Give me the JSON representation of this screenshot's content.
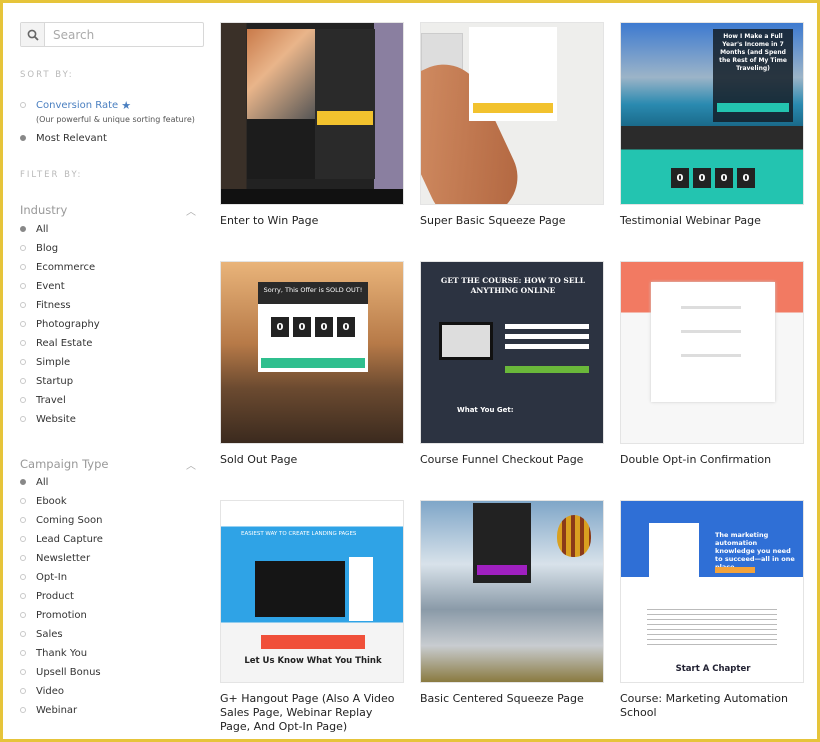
{
  "search": {
    "placeholder": "Search",
    "icon": "search-icon"
  },
  "sort": {
    "label": "SORT BY:",
    "options": [
      {
        "label": "Conversion Rate",
        "note": "(Our powerful & unique sorting feature)",
        "selected": false,
        "icon": "star-icon"
      },
      {
        "label": "Most Relevant",
        "selected": true
      }
    ]
  },
  "filter": {
    "label": "FILTER BY:"
  },
  "industry": {
    "heading": "Industry",
    "items": [
      "All",
      "Blog",
      "Ecommerce",
      "Event",
      "Fitness",
      "Photography",
      "Real Estate",
      "Simple",
      "Startup",
      "Travel",
      "Website"
    ],
    "selected": "All"
  },
  "campaign": {
    "heading": "Campaign Type",
    "items": [
      "All",
      "Ebook",
      "Coming Soon",
      "Lead Capture",
      "Newsletter",
      "Opt-In",
      "Product",
      "Promotion",
      "Sales",
      "Thank You",
      "Upsell Bonus",
      "Video",
      "Webinar"
    ],
    "selected": "All"
  },
  "templates": [
    {
      "title": "Enter to Win Page"
    },
    {
      "title": "Super Basic Squeeze Page"
    },
    {
      "title": "Testimonial Webinar Page",
      "headline": "How I Make a Full Year's Income in 7 Months (and Spend the Rest of My Time Traveling)",
      "digit": "0"
    },
    {
      "title": "Sold Out Page",
      "headline": "Sorry, This Offer is SOLD OUT!",
      "digit": "0"
    },
    {
      "title": "Course Funnel Checkout Page",
      "headline": "GET THE COURSE: HOW TO SELL ANYTHING ONLINE",
      "sub": "What You Get:"
    },
    {
      "title": "Double Opt-in Confirmation"
    },
    {
      "title": "G+ Hangout Page (Also A Video Sales Page, Webinar Replay Page, And Opt-In Page)",
      "headline": "EASIEST WAY TO CREATE LANDING PAGES",
      "sub": "Let Us Know What You Think"
    },
    {
      "title": "Basic Centered Squeeze Page"
    },
    {
      "title": "Course: Marketing Automation School",
      "headline": "The marketing automation knowledge you need to succeed—all in one place.",
      "sub": "Start A Chapter"
    }
  ],
  "colors": {
    "frame": "#e6c43a",
    "link": "#4a7fc0"
  }
}
